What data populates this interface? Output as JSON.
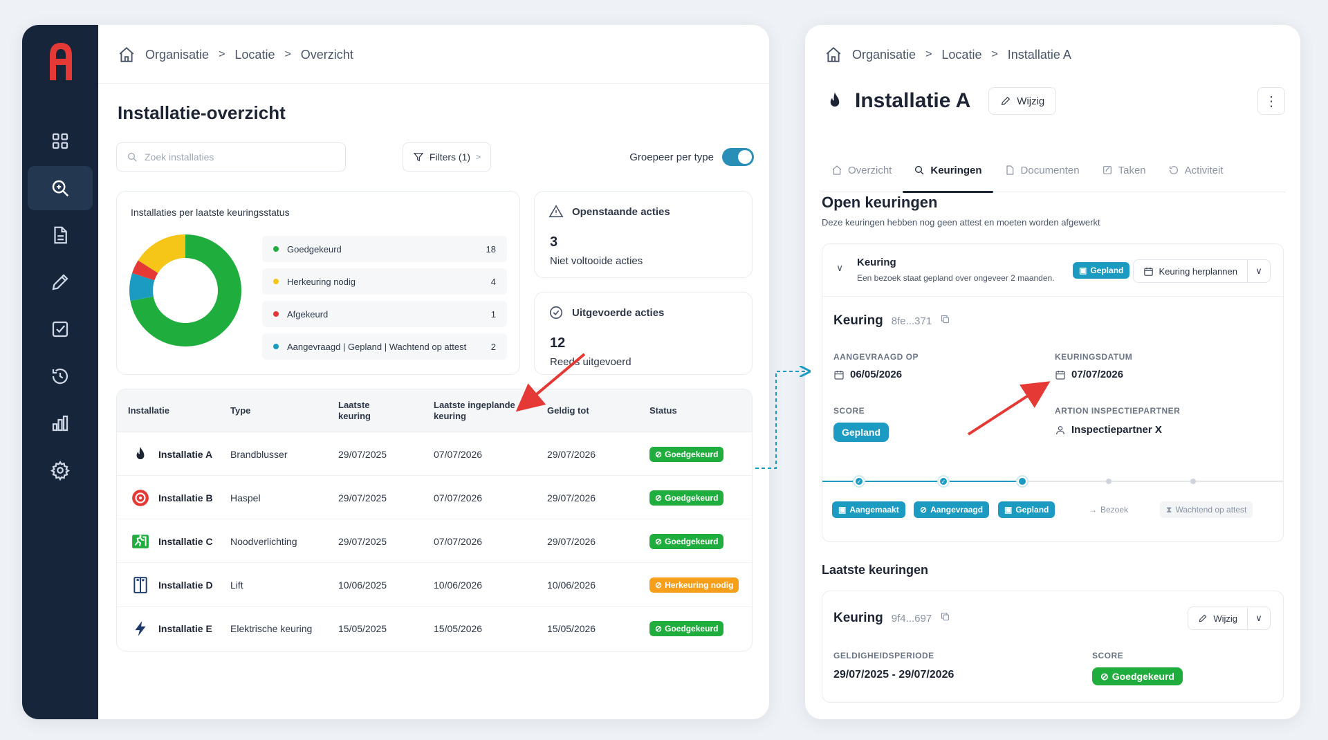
{
  "left": {
    "breadcrumb": [
      "Organisatie",
      "Locatie",
      "Overzicht"
    ],
    "title": "Installatie-overzicht",
    "search": {
      "placeholder": "Zoek installaties"
    },
    "filters_label": "Filters (1)",
    "group_label": "Groepeer per type",
    "group_on": true,
    "status_card": {
      "title": "Installaties per laatste keuringsstatus",
      "items": [
        {
          "label": "Goedgekeurd",
          "count": "18",
          "color": "#1fae3d"
        },
        {
          "label": "Herkeuring nodig",
          "count": "4",
          "color": "#f5c518"
        },
        {
          "label": "Afgekeurd",
          "count": "1",
          "color": "#e53935"
        },
        {
          "label": "Aangevraagd | Gepland | Wachtend op attest",
          "count": "2",
          "color": "#1b9ac2"
        }
      ]
    },
    "open_actions": {
      "title": "Openstaande acties",
      "number": "3",
      "sub": "Niet voltooide acties"
    },
    "done_actions": {
      "title": "Uitgevoerde acties",
      "number": "12",
      "sub": "Reeds uitgevoerd"
    },
    "table": {
      "headers": [
        "Installatie",
        "Type",
        "Laatste keuring",
        "Laatste ingeplande keuring",
        "Geldig tot",
        "Status"
      ],
      "rows": [
        {
          "icon": "flame-icon",
          "name": "Installatie A",
          "type": "Brandblusser",
          "last": "29/07/2025",
          "planned": "07/07/2026",
          "valid": "29/07/2026",
          "status": "Goedgekeurd",
          "status_color": "green"
        },
        {
          "icon": "hose-reel-icon",
          "name": "Installatie B",
          "type": "Haspel",
          "last": "29/07/2025",
          "planned": "07/07/2026",
          "valid": "29/07/2026",
          "status": "Goedgekeurd",
          "status_color": "green"
        },
        {
          "icon": "emergency-exit-icon",
          "name": "Installatie C",
          "type": "Noodverlichting",
          "last": "29/07/2025",
          "planned": "07/07/2026",
          "valid": "29/07/2026",
          "status": "Goedgekeurd",
          "status_color": "green"
        },
        {
          "icon": "elevator-icon",
          "name": "Installatie D",
          "type": "Lift",
          "last": "10/06/2025",
          "planned": "10/06/2026",
          "valid": "10/06/2026",
          "status": "Herkeuring nodig",
          "status_color": "orange"
        },
        {
          "icon": "lightning-icon",
          "name": "Installatie E",
          "type": "Elektrische keuring",
          "last": "15/05/2025",
          "planned": "15/05/2026",
          "valid": "15/05/2026",
          "status": "Goedgekeurd",
          "status_color": "green"
        }
      ]
    }
  },
  "right": {
    "breadcrumb": [
      "Organisatie",
      "Locatie",
      "Installatie A"
    ],
    "title": "Installatie A",
    "edit_label": "Wijzig",
    "tabs": [
      {
        "label": "Overzicht",
        "icon": "home-icon",
        "active": false
      },
      {
        "label": "Keuringen",
        "icon": "search-icon",
        "active": true
      },
      {
        "label": "Documenten",
        "icon": "document-icon",
        "active": false
      },
      {
        "label": "Taken",
        "icon": "edit-icon",
        "active": false
      },
      {
        "label": "Activiteit",
        "icon": "history-icon",
        "active": false
      }
    ],
    "open": {
      "title": "Open keuringen",
      "sub": "Deze keuringen hebben nog geen attest en moeten worden afgewerkt",
      "head_title": "Keuring",
      "head_sub": "Een bezoek staat gepland over ongeveer 2 maanden.",
      "head_badge": "Gepland",
      "reschedule_label": "Keuring herplannen",
      "keuring_title": "Keuring",
      "keuring_id": "8fe...371",
      "requested_label": "AANGEVRAAGD OP",
      "requested_value": "06/05/2026",
      "date_label": "KEURINGSDATUM",
      "date_value": "07/07/2026",
      "score_label": "SCORE",
      "score_value": "Gepland",
      "partner_label": "ARTION INSPECTIEPARTNER",
      "partner_value": "Inspectiepartner X",
      "steps": [
        {
          "label": "Aangemaakt",
          "done": true
        },
        {
          "label": "Aangevraagd",
          "done": true
        },
        {
          "label": "Gepland",
          "done": true
        },
        {
          "label": "Bezoek",
          "done": false
        },
        {
          "label": "Wachtend op attest",
          "done": false
        }
      ]
    },
    "last": {
      "title": "Laatste keuringen",
      "keuring_title": "Keuring",
      "keuring_id": "9f4...697",
      "edit_label": "Wijzig",
      "period_label": "GELDIGHEIDSPERIODE",
      "period_value": "29/07/2025 - 29/07/2026",
      "score_label": "SCORE",
      "score_value": "Goedgekeurd"
    }
  },
  "colors": {
    "sidebar": "#17253a",
    "accent": "#1b9ac2",
    "green": "#1fae3d",
    "orange": "#f59f1a",
    "red": "#e53935",
    "yellow": "#f5c518",
    "logo": "#e53935"
  }
}
